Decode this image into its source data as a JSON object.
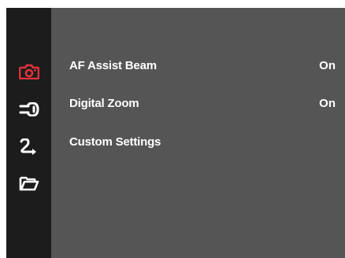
{
  "sidebar": {
    "icons": [
      {
        "name": "camera-icon",
        "color": "#e0323a",
        "active": true
      },
      {
        "name": "wrench-icon",
        "color": "#ffffff",
        "active": false
      },
      {
        "name": "playback-arrow-icon",
        "color": "#ffffff",
        "active": false
      },
      {
        "name": "folder-icon",
        "color": "#ffffff",
        "active": false
      }
    ]
  },
  "menu": {
    "items": [
      {
        "label": "AF Assist Beam",
        "value": "On"
      },
      {
        "label": "Digital Zoom",
        "value": "On"
      },
      {
        "label": "Custom Settings",
        "value": ""
      }
    ]
  },
  "colors": {
    "sidebar_bg": "#1c1c1c",
    "panel_bg": "#555555",
    "accent": "#e0323a",
    "text": "#ffffff"
  }
}
